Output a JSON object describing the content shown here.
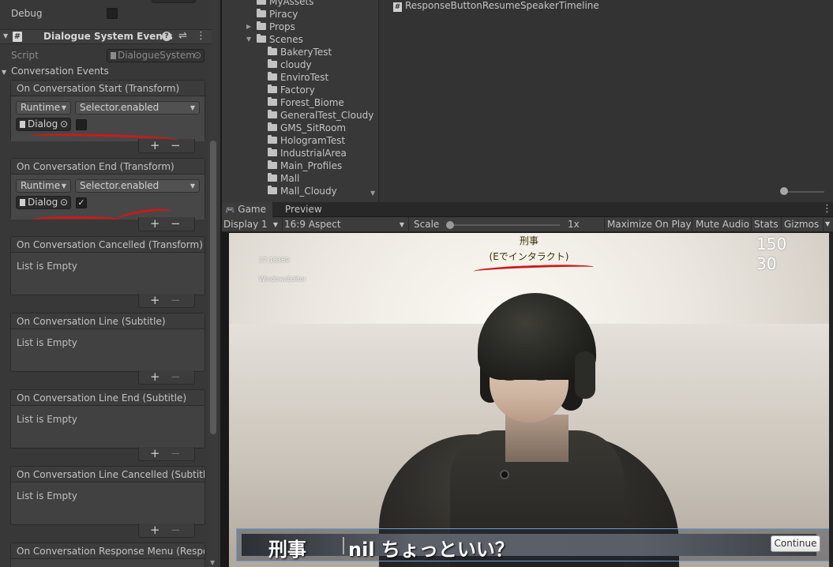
{
  "inspector": {
    "debug_label": "Debug",
    "component_title": "Dialogue System Events",
    "script_label": "Script",
    "script_value": "DialogueSystem",
    "section_label": "Conversation Events",
    "events": [
      {
        "title": "On Conversation Start (Transform)",
        "runtime": "Runtime",
        "function": "Selector.enabled",
        "object": "Dialog",
        "checked": false
      },
      {
        "title": "On Conversation End (Transform)",
        "runtime": "Runtime",
        "function": "Selector.enabled",
        "object": "Dialog",
        "checked": true
      },
      {
        "title": "On Conversation Cancelled (Transform)",
        "empty": "List is Empty"
      },
      {
        "title": "On Conversation Line (Subtitle)",
        "empty": "List is Empty"
      },
      {
        "title": "On Conversation Line End (Subtitle)",
        "empty": "List is Empty"
      },
      {
        "title": "On Conversation Line Cancelled (Subtitle",
        "empty": "List is Empty"
      },
      {
        "title": "On Conversation Response Menu (Respor"
      }
    ],
    "plus": "+",
    "minus": "−",
    "checkmark": "✓"
  },
  "project": {
    "folders": [
      {
        "name": "MyAssets",
        "depth": 1
      },
      {
        "name": "Piracy",
        "depth": 1
      },
      {
        "name": "Props",
        "depth": 1,
        "collapsed": true
      },
      {
        "name": "Scenes",
        "depth": 1,
        "expanded": true
      },
      {
        "name": "BakeryTest",
        "depth": 2
      },
      {
        "name": "cloudy",
        "depth": 2
      },
      {
        "name": "EnviroTest",
        "depth": 2
      },
      {
        "name": "Factory",
        "depth": 2
      },
      {
        "name": "Forest_Biome",
        "depth": 2
      },
      {
        "name": "GeneralTest_Cloudy",
        "depth": 2
      },
      {
        "name": "GMS_SitRoom",
        "depth": 2
      },
      {
        "name": "HologramTest",
        "depth": 2
      },
      {
        "name": "IndustrialArea",
        "depth": 2
      },
      {
        "name": "Main_Profiles",
        "depth": 2
      },
      {
        "name": "Mall",
        "depth": 2
      },
      {
        "name": "Mall_Cloudy",
        "depth": 2
      }
    ],
    "asset": "ResponseButtonResumeSpeakerTimeline"
  },
  "game": {
    "tab_game": "Game",
    "tab_preview": "Preview",
    "display": "Display 1",
    "aspect": "16:9 Aspect",
    "scale_label": "Scale",
    "scale_value": "1x",
    "maximize": "Maximize On Play",
    "mute": "Mute Audio",
    "stats": "Stats",
    "gizmos": "Gizmos",
    "more_icon": "⋮",
    "overlay": {
      "time": "27.18369",
      "platform": "WindowsEditor",
      "num1": "150",
      "num2": "30",
      "npc_name": "刑事",
      "npc_hint": "(Eでインタラクト)"
    },
    "dialogue": {
      "speaker": "刑事",
      "line": "nil ちょっといい？",
      "continue": "Continue"
    }
  },
  "colors": {
    "annotation_red": "#d01818",
    "dialogue_border": "#6f9bd0"
  }
}
